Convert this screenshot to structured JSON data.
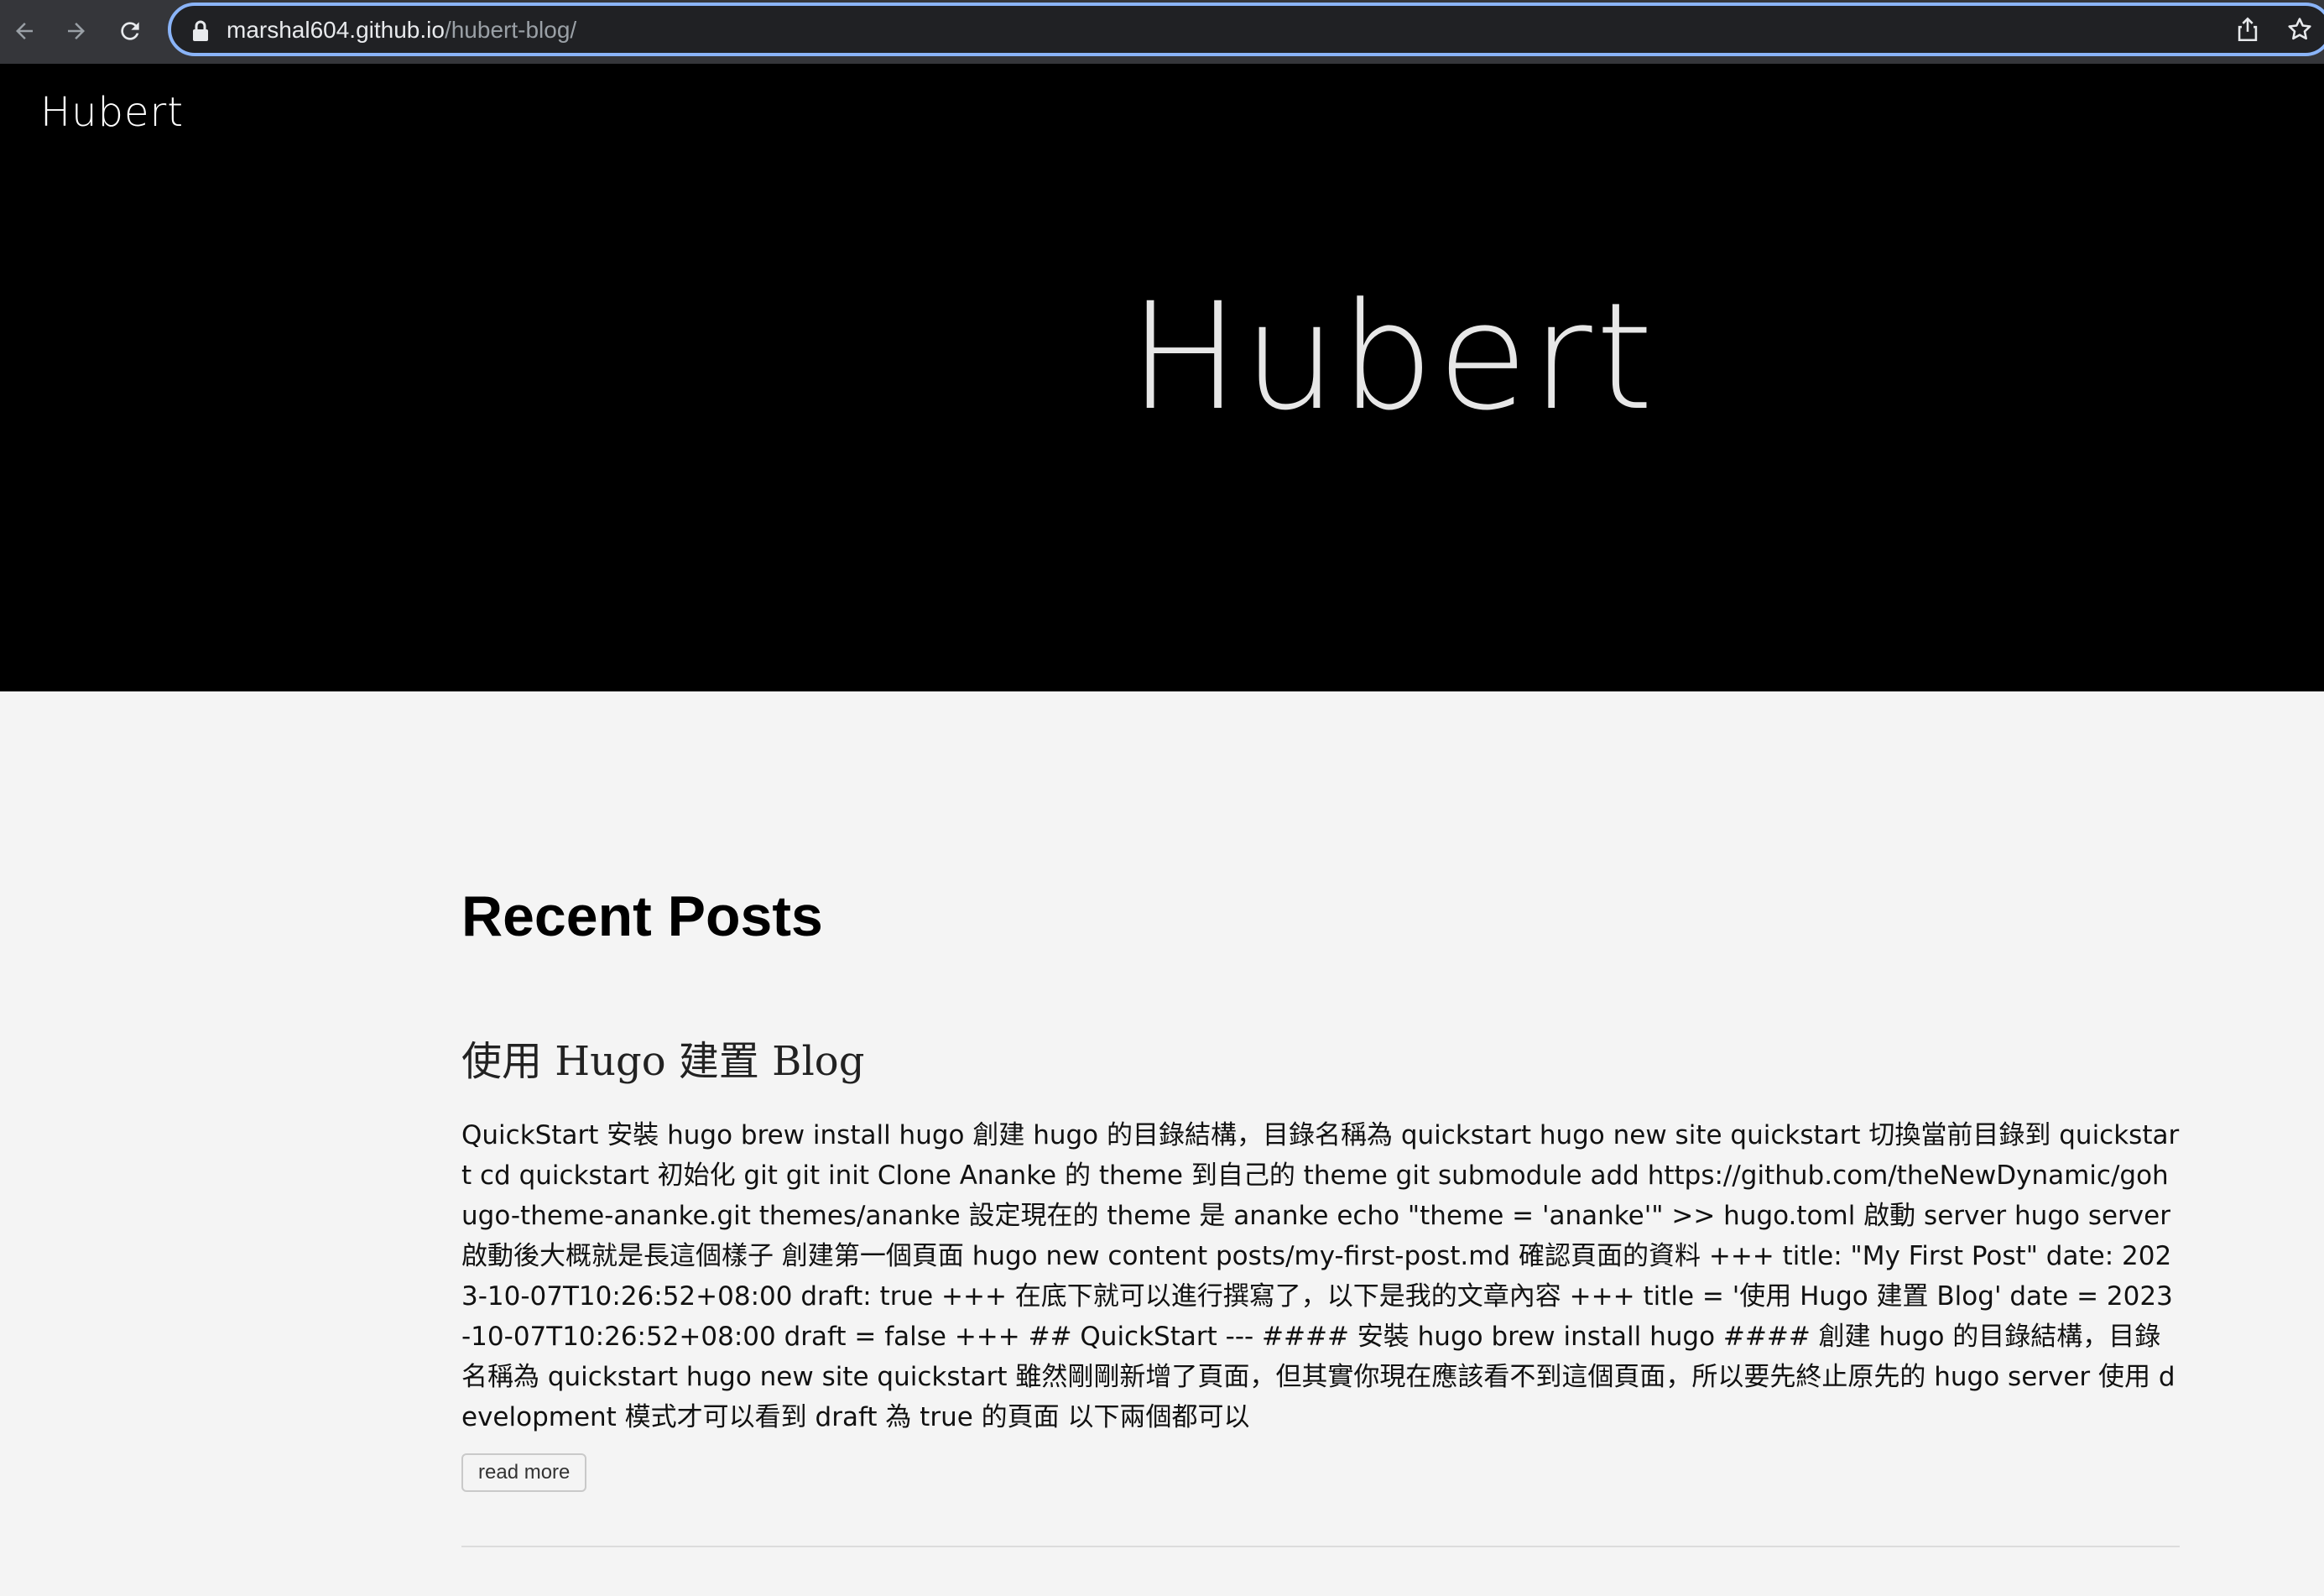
{
  "browser": {
    "url_host": "marshal604.github.io",
    "url_path": "/hubert-blog/",
    "icons": {
      "back": "arrow-left-icon",
      "forward": "arrow-right-icon",
      "reload": "reload-icon",
      "lock": "lock-icon",
      "share": "share-icon",
      "bookmark": "star-icon"
    }
  },
  "site": {
    "logo": "Hubert",
    "hero_title": "Hubert"
  },
  "main": {
    "section_title": "Recent Posts",
    "posts": [
      {
        "title": "使用 Hugo 建置 Blog",
        "summary": "QuickStart 安裝 hugo brew install hugo 創建 hugo 的目錄結構，目錄名稱為 quickstart hugo new site quickstart 切換當前目錄到 quickstart cd quickstart 初始化 git git init Clone Ananke 的 theme 到自己的 theme git submodule add https://github.com/theNewDynamic/gohugo-theme-ananke.git themes/ananke 設定現在的 theme 是 ananke echo \"theme = 'ananke'\" >> hugo.toml 啟動 server hugo server 啟動後大概就是長這個樣子 創建第一個頁面 hugo new content posts/my-first-post.md 確認頁面的資料 +++ title: \"My First Post\" date: 2023-10-07T10:26:52+08:00 draft: true +++ 在底下就可以進行撰寫了，以下是我的文章內容 +++ title = '使用 Hugo 建置 Blog' date = 2023-10-07T10:26:52+08:00 draft = false +++ ## QuickStart --- #### 安裝 hugo brew install hugo #### 創建 hugo 的目錄結構，目錄名稱為 quickstart hugo new site quickstart 雖然剛剛新增了頁面，但其實你現在應該看不到這個頁面，所以要先終止原先的 hugo server 使用 development 模式才可以看到 draft 為 true 的頁面 以下兩個都可以",
        "read_more": "read more"
      }
    ]
  },
  "colors": {
    "hero_background": "#000000",
    "page_background": "#f4f4f4",
    "omnibox_focus": "#8ab4f8"
  }
}
